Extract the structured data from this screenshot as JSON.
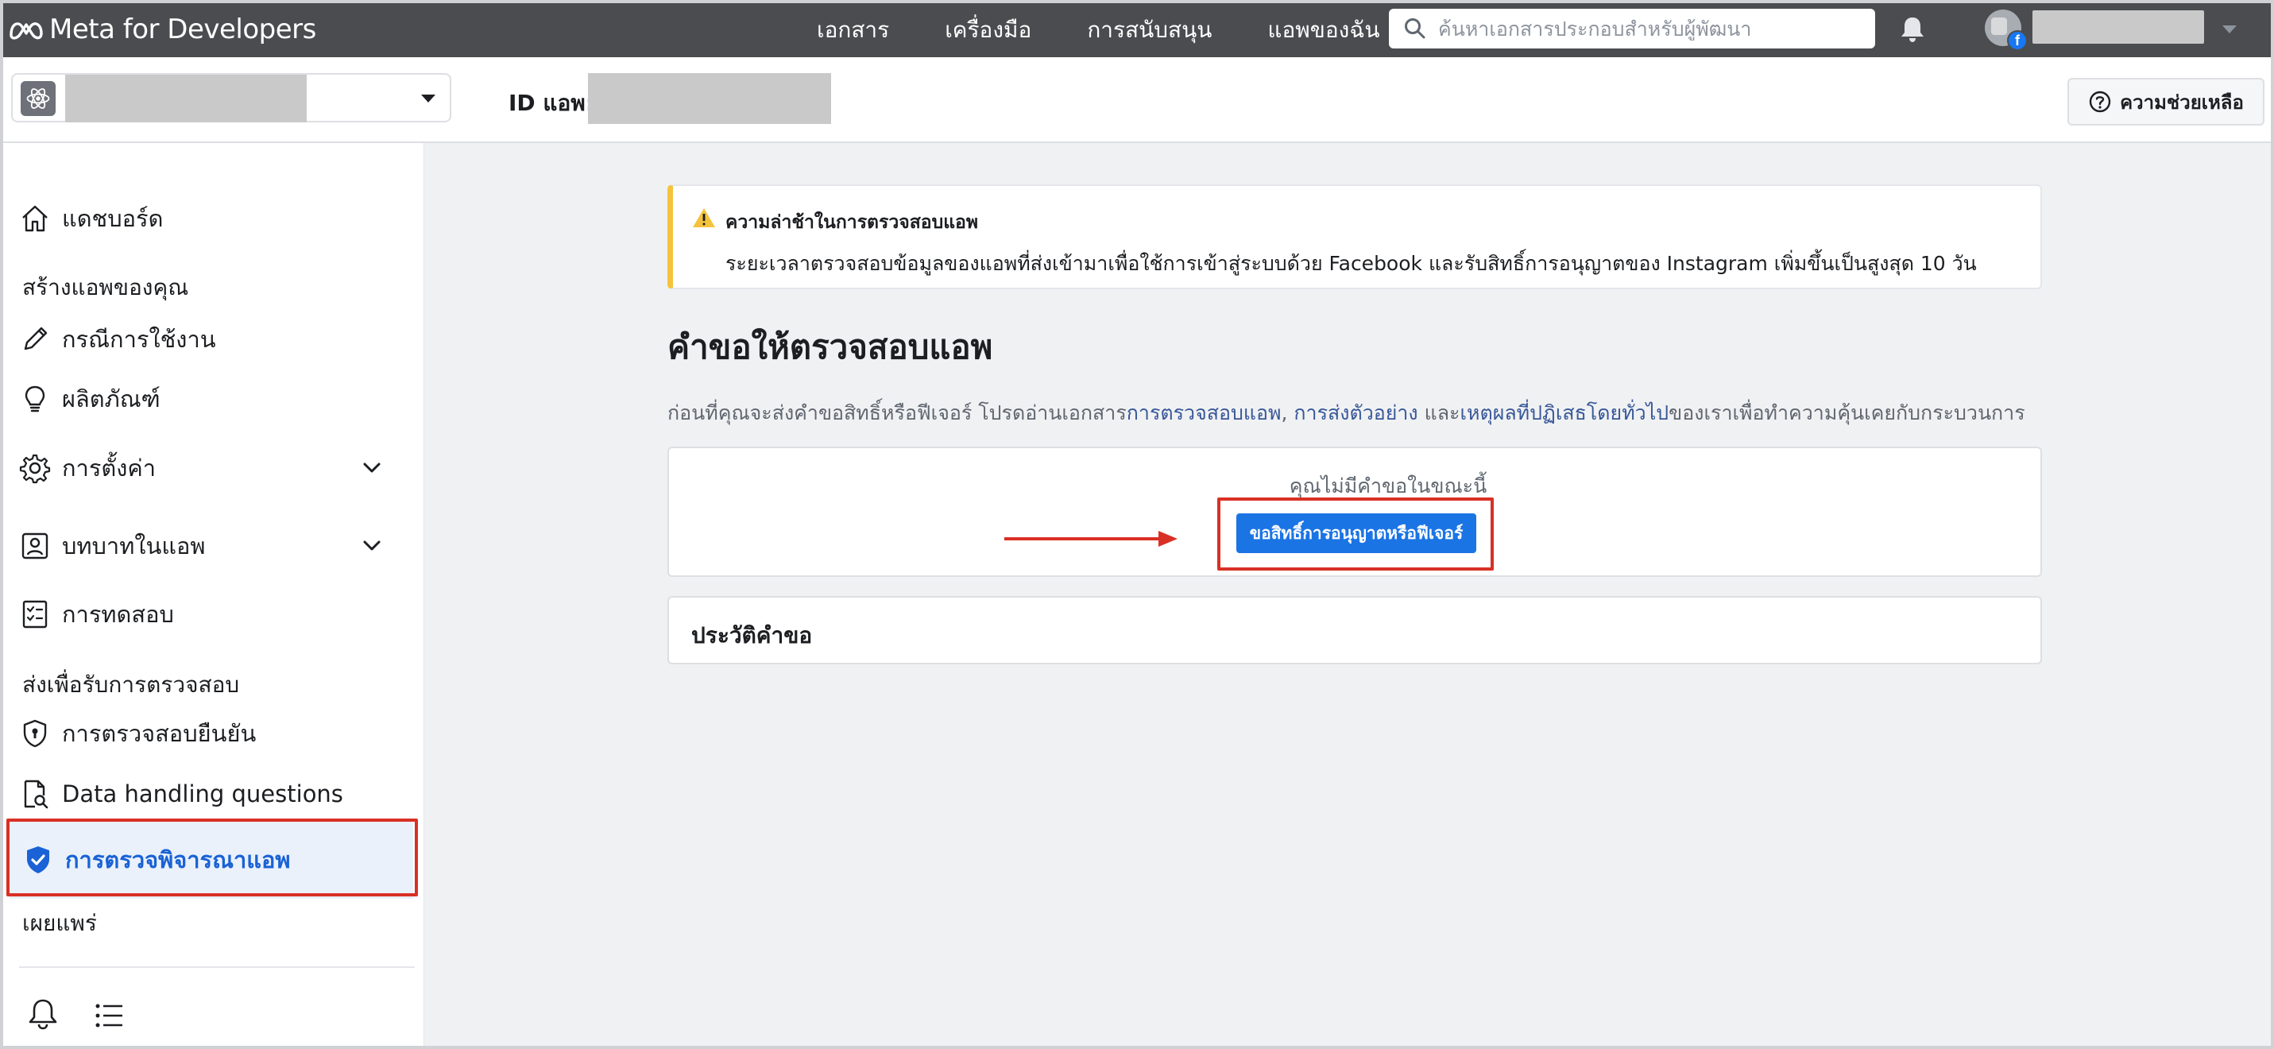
{
  "topnav": {
    "brand": "Meta for Developers",
    "links": [
      "เอกสาร",
      "เครื่องมือ",
      "การสนับสนุน",
      "แอพของฉัน"
    ],
    "search_placeholder": "ค้นหาเอกสารประกอบสำหรับผู้พัฒนา",
    "user_badge": "f"
  },
  "subheader": {
    "app_id_label": "ID แอพ:",
    "help_label": "ความช่วยเหลือ"
  },
  "sidebar": {
    "items": [
      {
        "label": "แดชบอร์ด",
        "icon": "home-icon"
      },
      {
        "label": "กรณีการใช้งาน",
        "icon": "pencil-icon"
      },
      {
        "label": "ผลิตภัณฑ์",
        "icon": "lightbulb-icon"
      },
      {
        "label": "การตั้งค่า",
        "icon": "gear-icon"
      },
      {
        "label": "บทบาทในแอพ",
        "icon": "person-badge-icon"
      },
      {
        "label": "การทดสอบ",
        "icon": "checklist-icon"
      },
      {
        "label": "การตรวจสอบยืนยัน",
        "icon": "shield-lock-icon"
      },
      {
        "label": "Data handling questions",
        "icon": "document-search-icon"
      },
      {
        "label": "การตรวจพิจารณาแอพ",
        "icon": "shield-check-icon"
      }
    ],
    "sections": {
      "build": "สร้างแอพของคุณ",
      "submit": "ส่งเพื่อรับการตรวจสอบ",
      "publish": "เผยแพร่"
    },
    "active_item": "การตรวจพิจารณาแอพ"
  },
  "main": {
    "alert": {
      "title": "ความล่าช้าในการตรวจสอบแอพ",
      "body": "ระยะเวลาตรวจสอบข้อมูลของแอพที่ส่งเข้ามาเพื่อใช้การเข้าสู่ระบบด้วย Facebook และรับสิทธิ์การอนุญาตของ Instagram เพิ่มขึ้นเป็นสูงสุด 10 วัน"
    },
    "heading": "คำขอให้ตรวจสอบแอพ",
    "intro": {
      "prefix": "ก่อนที่คุณจะส่งคำขอสิทธิ์หรือฟีเจอร์ โปรดอ่านเอกสาร",
      "link1": "การตรวจสอบแอพ",
      "sep1": ", ",
      "link2": "การส่งตัวอย่าง",
      "sep2": " และ",
      "link3": "เหตุผลที่ปฏิเสธโดยทั่วไป",
      "suffix": "ของเราเพื่อทำความคุ้นเคยกับกระบวนการ"
    },
    "empty_text": "คุณไม่มีคำขอในขณะนี้",
    "request_button": "ขอสิทธิ์การอนุญาตหรือฟีเจอร์",
    "history_title": "ประวัติคำขอ"
  },
  "colors": {
    "topnav_bg": "#4b4c4f",
    "primary_button": "#1b74e4",
    "link": "#385898",
    "active_text": "#1a62d5",
    "warning_accent": "#f5c33b",
    "annotation_red": "#d93025"
  }
}
